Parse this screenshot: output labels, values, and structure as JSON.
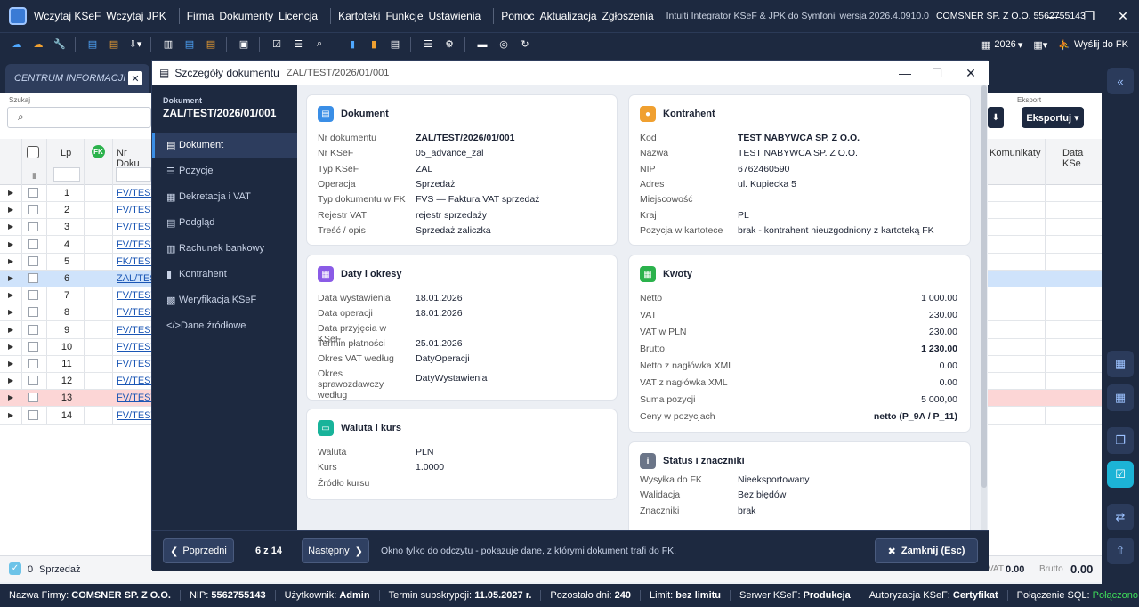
{
  "app": {
    "menu": [
      "Wczytaj KSeF",
      "Wczytaj JPK",
      "Firma",
      "Dokumenty",
      "Licencja",
      "Kartoteki",
      "Funkcje",
      "Ustawienia",
      "Pomoc",
      "Aktualizacja",
      "Zgłoszenia"
    ],
    "product": "Intuiti Integrator KSeF & JPK do Symfonii wersja 2026.4.0910.0",
    "company_nip": "COMSNER SP. Z O.O.   5562755143"
  },
  "toolbar": {
    "year": "2026",
    "send_fk": "Wyślij do FK"
  },
  "tab": {
    "label": "CENTRUM INFORMACJI",
    "close": "✕"
  },
  "grid": {
    "search_label": "Szukaj",
    "export_label": "Eksport",
    "export_button": "Eksportuj ▾",
    "col_lp": "Lp",
    "col_fk": "FK",
    "col_doc": "Nr Doku",
    "col_komunikaty": "Komunikaty",
    "col_data_ksef": "Data KSe",
    "rows": [
      {
        "lp": "1",
        "doc": "FV/TEST/"
      },
      {
        "lp": "2",
        "doc": "FV/TEST/"
      },
      {
        "lp": "3",
        "doc": "FV/TEST/"
      },
      {
        "lp": "4",
        "doc": "FV/TEST/"
      },
      {
        "lp": "5",
        "doc": "FK/TEST/"
      },
      {
        "lp": "6",
        "doc": "ZAL/TEST/"
      },
      {
        "lp": "7",
        "doc": "FV/TEST/"
      },
      {
        "lp": "8",
        "doc": "FV/TEST/"
      },
      {
        "lp": "9",
        "doc": "FV/TEST/"
      },
      {
        "lp": "10",
        "doc": "FV/TEST/"
      },
      {
        "lp": "11",
        "doc": "FV/TEST/"
      },
      {
        "lp": "12",
        "doc": "FV/TEST/"
      },
      {
        "lp": "13",
        "doc": "FV/TEST/"
      },
      {
        "lp": "14",
        "doc": "FV/TEST/"
      }
    ]
  },
  "summary": {
    "count": "0",
    "label": "Sprzedaż",
    "netto": "Netto",
    "vat": "VAT",
    "vat_val": "0.00",
    "brutto": "Brutto",
    "brutto_val": "0.00"
  },
  "status": {
    "firma_l": "Nazwa Firmy:",
    "firma": "COMSNER SP. Z O.O.",
    "nip_l": "NIP:",
    "nip": "5562755143",
    "user_l": "Użytkownik:",
    "user": "Admin",
    "term_l": "Termin subskrypcji:",
    "term": "11.05.2027 r.",
    "days_l": "Pozostało dni:",
    "days": "240",
    "limit_l": "Limit:",
    "limit": "bez limitu",
    "srv_l": "Serwer KSeF:",
    "srv": "Produkcja",
    "auth_l": "Autoryzacja KSeF:",
    "auth": "Certyfikat",
    "sql_l": "Połączenie SQL:",
    "sql": "Połączono"
  },
  "modal": {
    "title": "Szczegóły dokumentu",
    "subtitle": "ZAL/TEST/2026/01/001",
    "doc_label": "Dokument",
    "doc_number": "ZAL/TEST/2026/01/001",
    "nav": [
      "Dokument",
      "Pozycje",
      "Dekretacja i VAT",
      "Podgląd",
      "Rachunek bankowy",
      "Kontrahent",
      "Weryfikacja KSeF",
      "Dane źródłowe"
    ],
    "cards": {
      "dokument": {
        "title": "Dokument",
        "fields": [
          {
            "l": "Nr dokumentu",
            "v": "ZAL/TEST/2026/01/001"
          },
          {
            "l": "Nr KSeF",
            "v": "05_advance_zal"
          },
          {
            "l": "Typ KSeF",
            "v": "ZAL"
          },
          {
            "l": "Operacja",
            "v": "Sprzedaż"
          },
          {
            "l": "Typ dokumentu w FK",
            "v": "FVS — Faktura VAT sprzedaż"
          },
          {
            "l": "Rejestr VAT",
            "v": "rejestr sprzedaży"
          },
          {
            "l": "Treść / opis",
            "v": "Sprzedaż zaliczka"
          }
        ]
      },
      "kontrahent": {
        "title": "Kontrahent",
        "fields": [
          {
            "l": "Kod",
            "v": "TEST NABYWCA SP. Z O.O."
          },
          {
            "l": "Nazwa",
            "v": "TEST NABYWCA SP. Z O.O."
          },
          {
            "l": "NIP",
            "v": "6762460590"
          },
          {
            "l": "Adres",
            "v": "ul. Kupiecka 5"
          },
          {
            "l": "Miejscowość",
            "v": ""
          },
          {
            "l": "Kraj",
            "v": "PL"
          },
          {
            "l": "Pozycja w kartotece",
            "v": "brak - kontrahent nieuzgodniony z kartoteką FK"
          }
        ]
      },
      "daty": {
        "title": "Daty i okresy",
        "fields": [
          {
            "l": "Data wystawienia",
            "v": "18.01.2026"
          },
          {
            "l": "Data operacji",
            "v": "18.01.2026"
          },
          {
            "l": "Data przyjęcia w KSeF",
            "v": ""
          },
          {
            "l": "Termin płatności",
            "v": "25.01.2026"
          },
          {
            "l": "Okres VAT według",
            "v": "DatyOperacji"
          },
          {
            "l": "Okres sprawozdawczy według",
            "v": "DatyWystawienia"
          }
        ]
      },
      "kwoty": {
        "title": "Kwoty",
        "fields": [
          {
            "l": "Netto",
            "v": "1 000.00"
          },
          {
            "l": "VAT",
            "v": "230.00"
          },
          {
            "l": "VAT w PLN",
            "v": "230.00"
          },
          {
            "l": "Brutto",
            "v": "1 230.00"
          },
          {
            "l": "Netto z nagłówka XML",
            "v": "0.00"
          },
          {
            "l": "VAT z nagłówka XML",
            "v": "0.00"
          },
          {
            "l": "Suma pozycji",
            "v": "5 000,00"
          },
          {
            "l": "Ceny w pozycjach",
            "v": "netto (P_9A / P_11)"
          }
        ]
      },
      "waluta": {
        "title": "Waluta i kurs",
        "fields": [
          {
            "l": "Waluta",
            "v": "PLN"
          },
          {
            "l": "Kurs",
            "v": "1.0000"
          },
          {
            "l": "Źródło kursu",
            "v": ""
          }
        ]
      },
      "status": {
        "title": "Status i znaczniki",
        "fields": [
          {
            "l": "Wysyłka do FK",
            "v": "Nieeksportowany"
          },
          {
            "l": "Walidacja",
            "v": "Bez błędów"
          },
          {
            "l": "Znaczniki",
            "v": "brak"
          }
        ]
      }
    },
    "footer": {
      "prev": "Poprzedni",
      "page": "6 z 14",
      "next": "Następny",
      "note": "Okno tylko do odczytu - pokazuje dane, z którymi dokument trafi do FK.",
      "close": "Zamknij (Esc)"
    }
  }
}
